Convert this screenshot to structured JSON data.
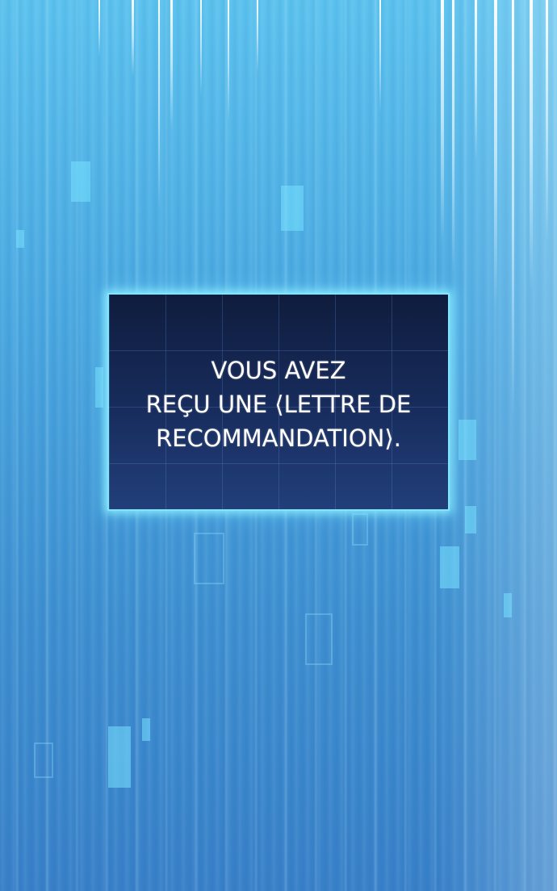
{
  "scene": {
    "background_colors": [
      "#5cc2ee",
      "#4aa8e0",
      "#3e8fd0",
      "#3880c8"
    ],
    "accent_glow": "#7ee6ff"
  },
  "notification": {
    "line1": "VOUS AVEZ",
    "line2": "REÇU UNE ⟨LETTRE DE",
    "line3": "RECOMMANDATION⟩."
  }
}
